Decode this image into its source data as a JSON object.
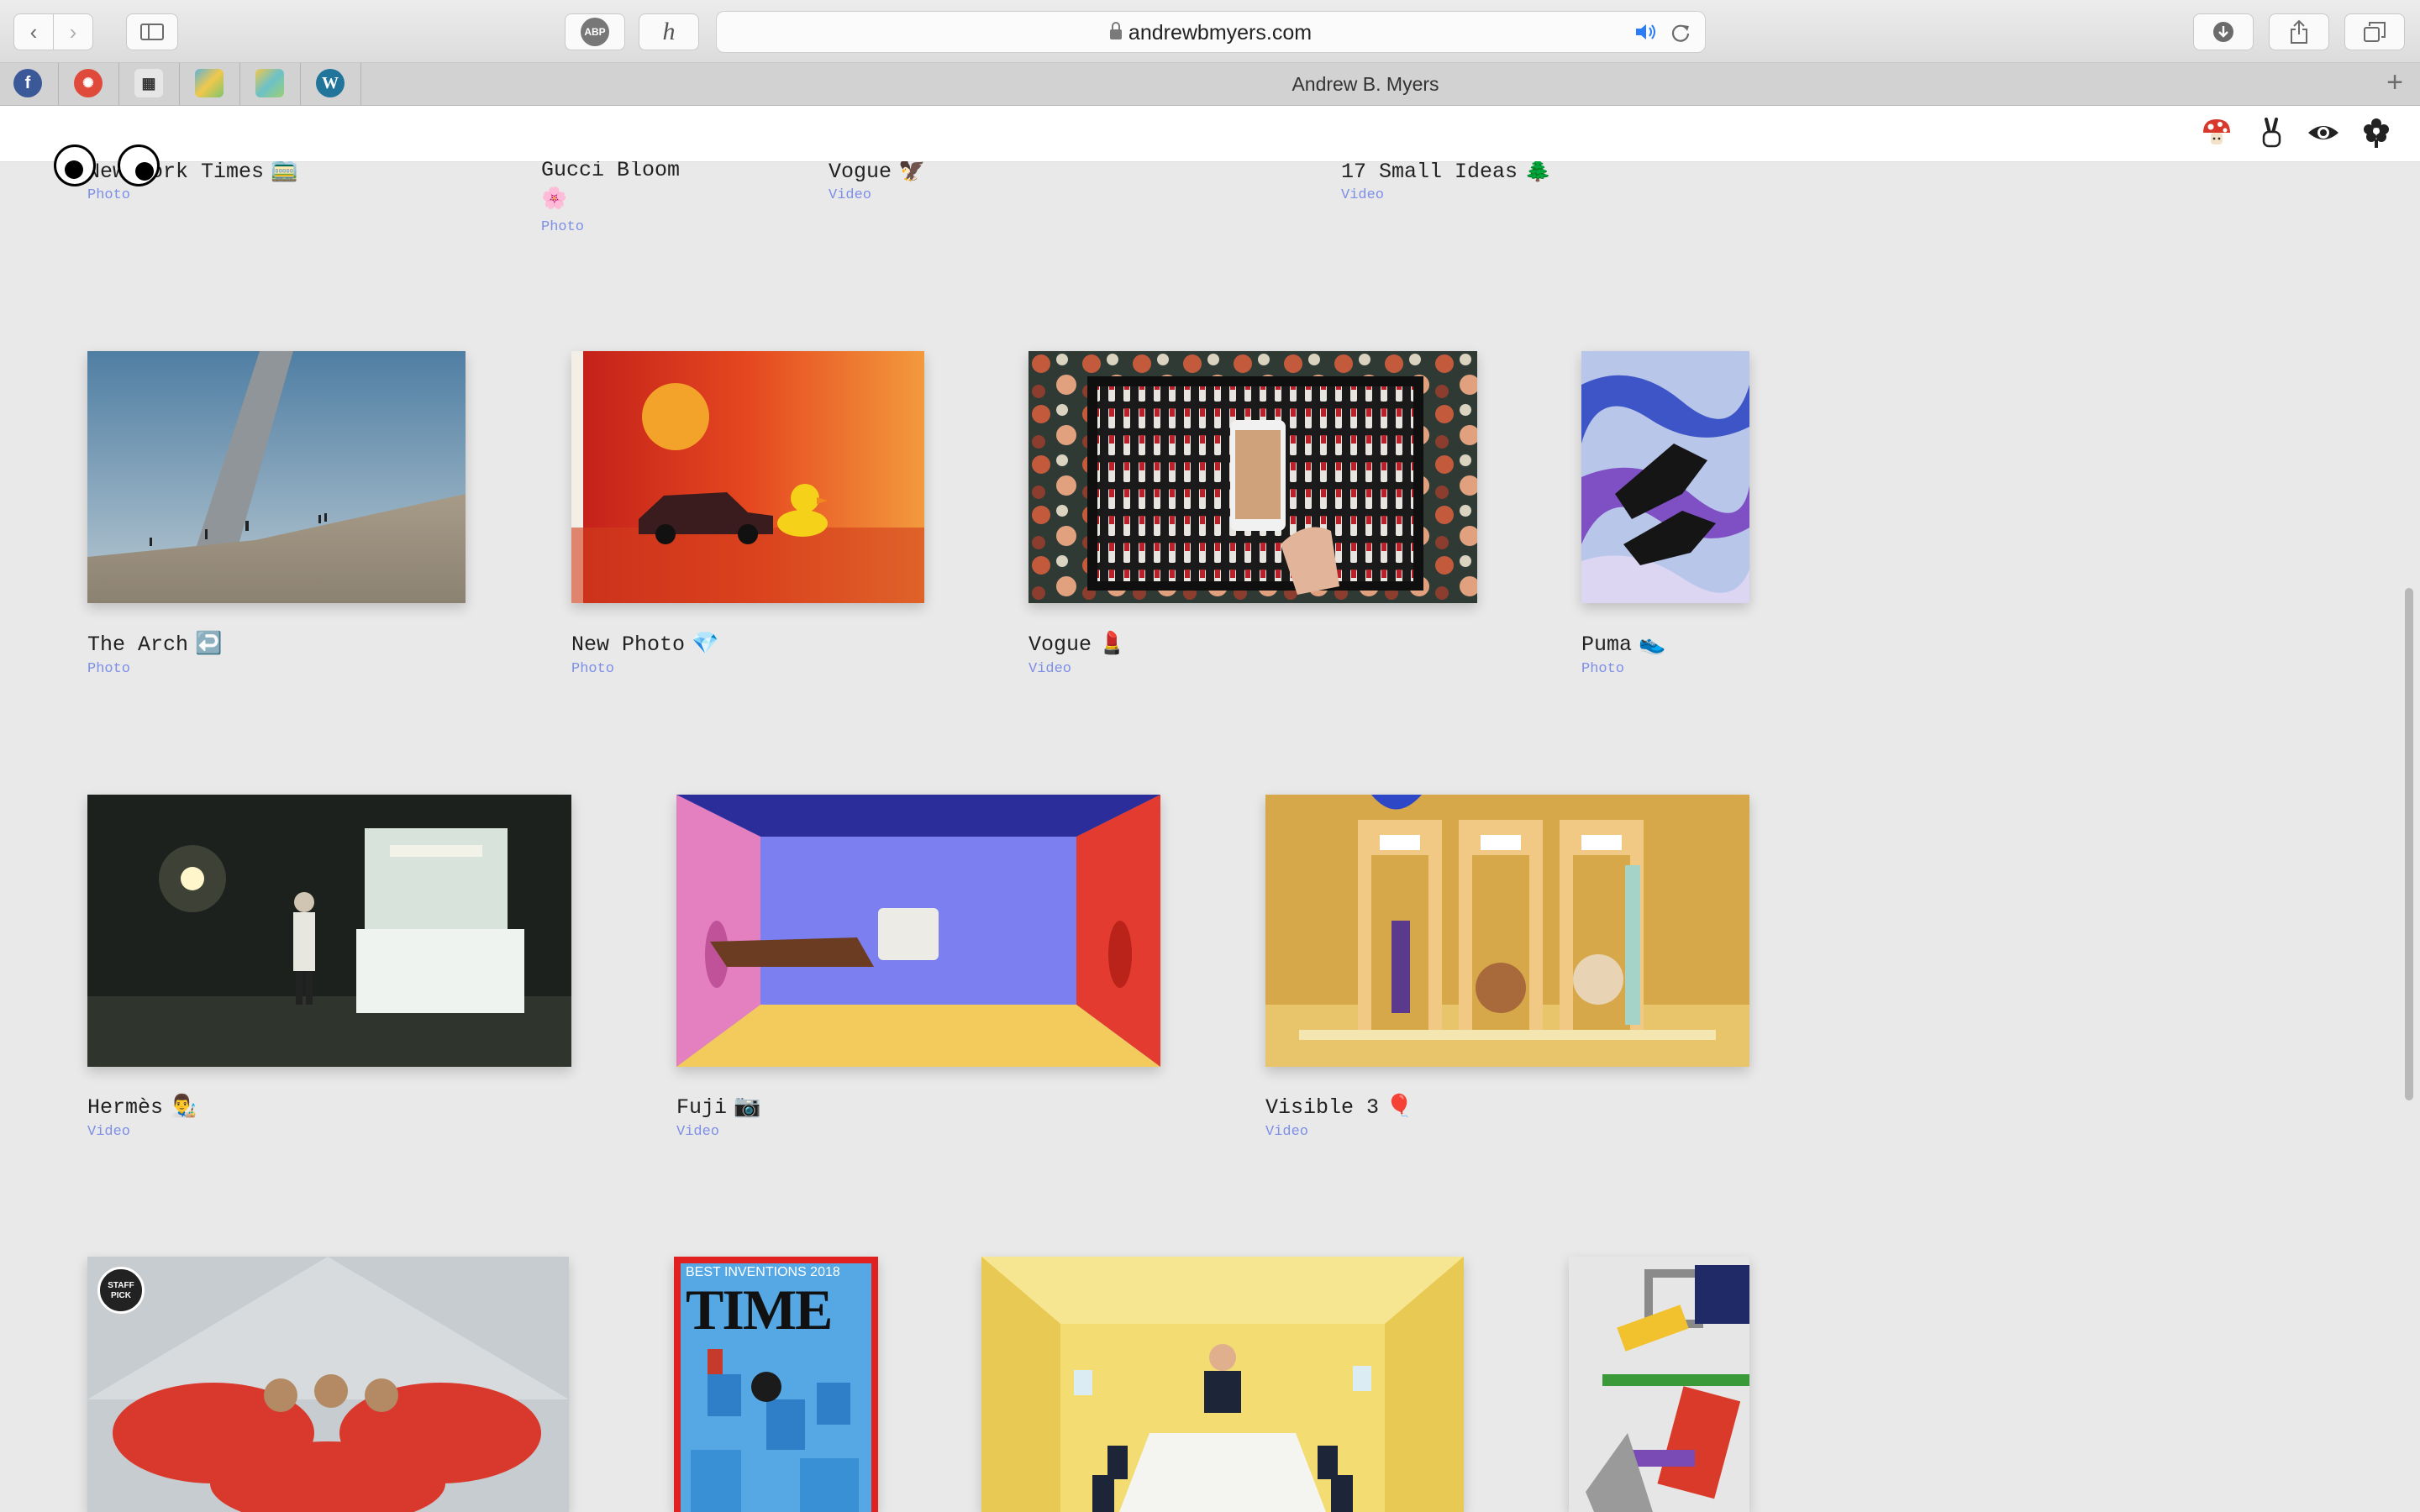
{
  "browser": {
    "url": "andrewbmyers.com",
    "tab_title": "Andrew B. Myers",
    "abp_label": "ABP",
    "honey_label": "h"
  },
  "site": {
    "header_icons": [
      "mushroom-icon",
      "victory-hand-icon",
      "eye-icon",
      "flower-icon"
    ]
  },
  "projects_row0": [
    {
      "title": "New York Times",
      "emoji": "🚞",
      "kind": "Photo"
    },
    {
      "title": "Gucci Bloom",
      "emoji": "🌸",
      "kind": "Photo"
    },
    {
      "title": "Vogue",
      "emoji": "🦅",
      "kind": "Video"
    },
    {
      "title": "17 Small Ideas",
      "emoji": "🌲",
      "kind": "Video"
    }
  ],
  "projects_row1": [
    {
      "title": "The Arch",
      "emoji": "↩️",
      "kind": "Photo"
    },
    {
      "title": "New Photo",
      "emoji": "💎",
      "kind": "Photo"
    },
    {
      "title": "Vogue",
      "emoji": "💄",
      "kind": "Video"
    },
    {
      "title": "Puma",
      "emoji": "👟",
      "kind": "Photo"
    }
  ],
  "projects_row2": [
    {
      "title": "Hermès",
      "emoji": "👨‍🎨",
      "kind": "Video"
    },
    {
      "title": "Fuji",
      "emoji": "📷",
      "kind": "Video"
    },
    {
      "title": "Visible 3",
      "emoji": "🎈",
      "kind": "Video"
    }
  ],
  "row3": {
    "staff_pick_badge": "STAFF PICK",
    "time_cover_banner": "BEST INVENTIONS 2018",
    "time_masthead": "TIME"
  }
}
